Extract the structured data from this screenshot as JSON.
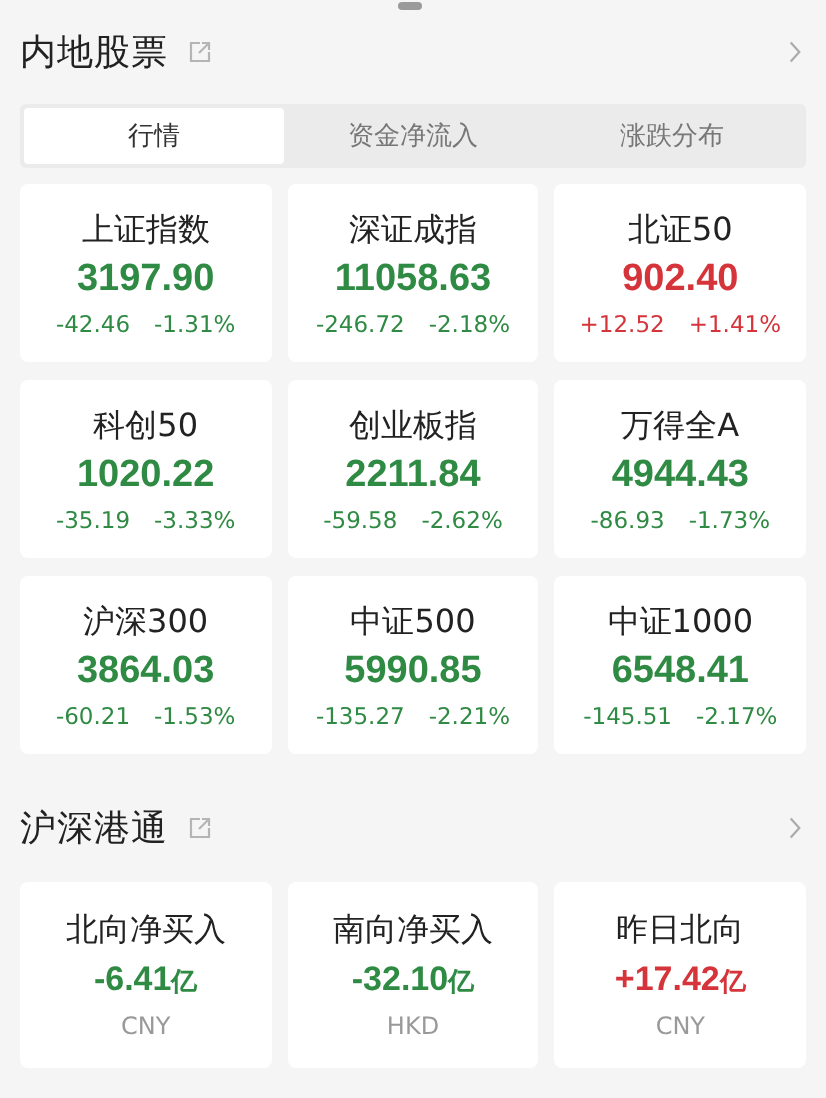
{
  "sections": [
    {
      "title": "内地股票",
      "tabs": [
        {
          "label": "行情",
          "selected": true
        },
        {
          "label": "资金净流入",
          "selected": false
        },
        {
          "label": "涨跌分布",
          "selected": false
        }
      ],
      "indices": [
        {
          "name": "上证指数",
          "value": "3197.90",
          "change": "-42.46",
          "percent": "-1.31%",
          "rising": false
        },
        {
          "name": "深证成指",
          "value": "11058.63",
          "change": "-246.72",
          "percent": "-2.18%",
          "rising": false
        },
        {
          "name": "北证50",
          "value": "902.40",
          "change": "+12.52",
          "percent": "+1.41%",
          "rising": true
        },
        {
          "name": "科创50",
          "value": "1020.22",
          "change": "-35.19",
          "percent": "-3.33%",
          "rising": false
        },
        {
          "name": "创业板指",
          "value": "2211.84",
          "change": "-59.58",
          "percent": "-2.62%",
          "rising": false
        },
        {
          "name": "万得全A",
          "value": "4944.43",
          "change": "-86.93",
          "percent": "-1.73%",
          "rising": false
        },
        {
          "name": "沪深300",
          "value": "3864.03",
          "change": "-60.21",
          "percent": "-1.53%",
          "rising": false
        },
        {
          "name": "中证500",
          "value": "5990.85",
          "change": "-135.27",
          "percent": "-2.21%",
          "rising": false
        },
        {
          "name": "中证1000",
          "value": "6548.41",
          "change": "-145.51",
          "percent": "-2.17%",
          "rising": false
        }
      ]
    },
    {
      "title": "沪深港通",
      "flows": [
        {
          "name": "北向净买入",
          "value": "-6.41",
          "unit": "亿",
          "currency": "CNY",
          "rising": false
        },
        {
          "name": "南向净买入",
          "value": "-32.10",
          "unit": "亿",
          "currency": "HKD",
          "rising": false
        },
        {
          "name": "昨日北向",
          "value": "+17.42",
          "unit": "亿",
          "currency": "CNY",
          "rising": true
        }
      ]
    }
  ]
}
